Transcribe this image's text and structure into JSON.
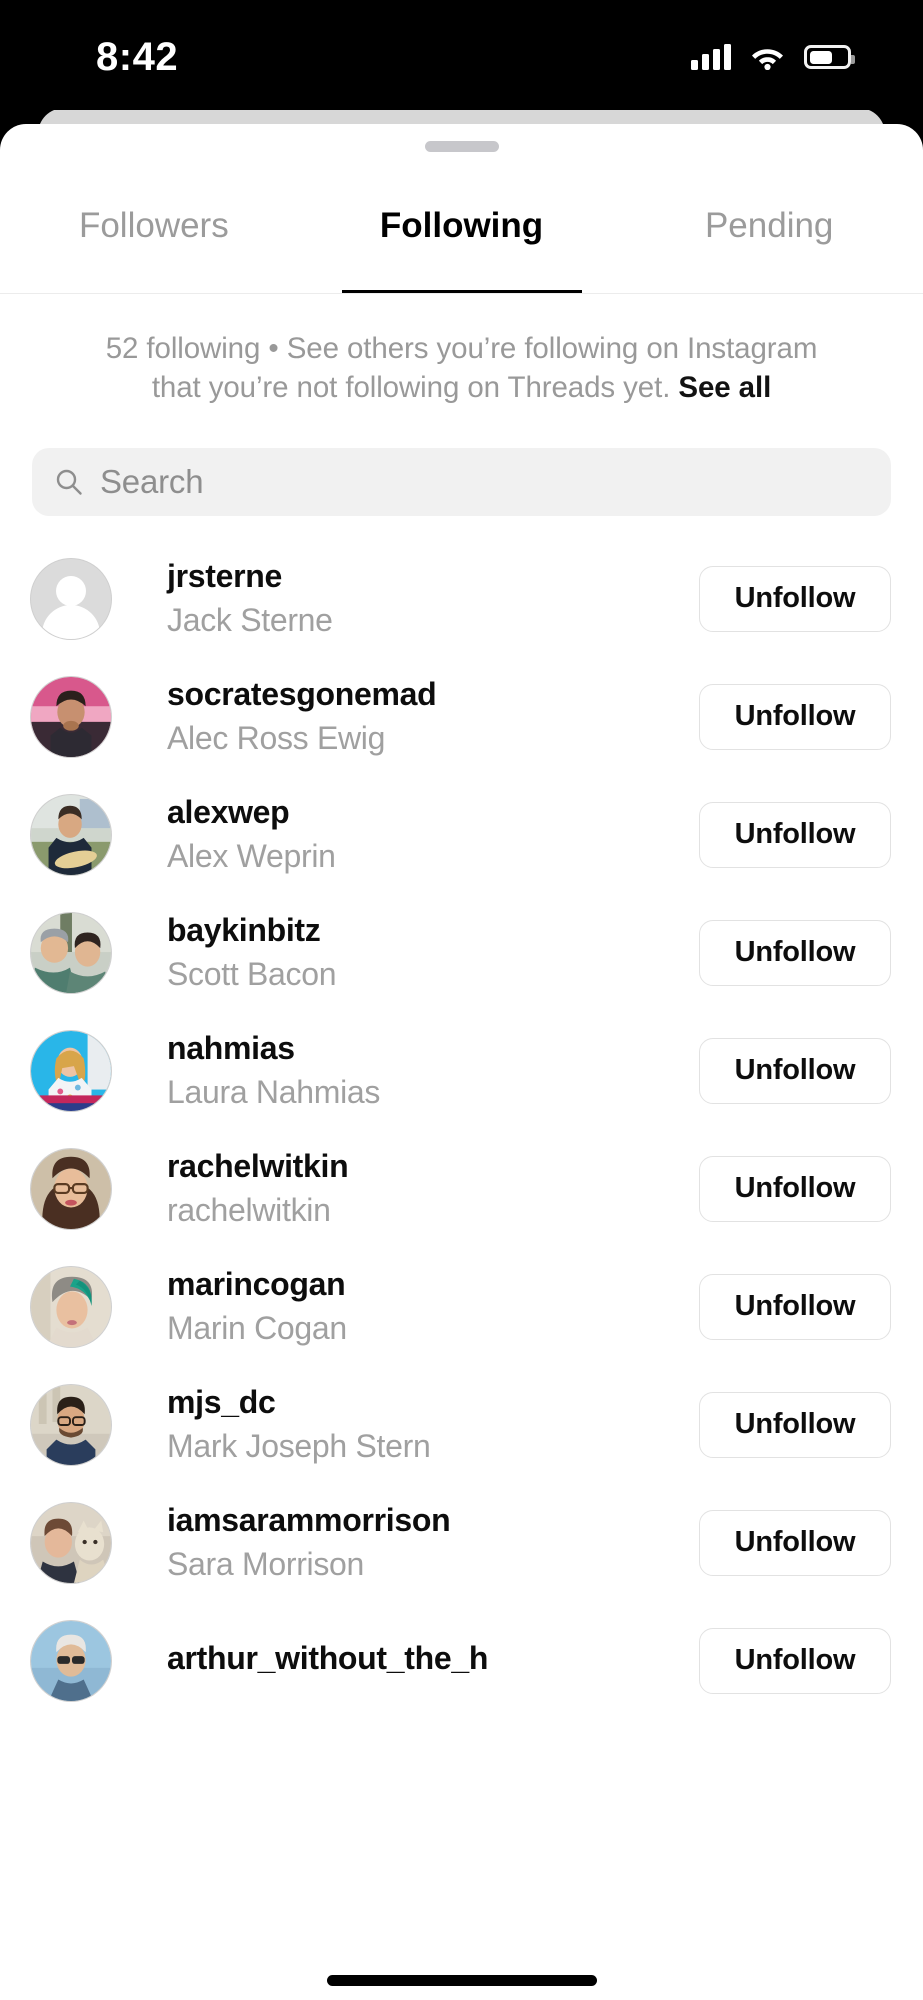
{
  "status_bar": {
    "time": "8:42",
    "cellular_icon": "cellular-signal-icon",
    "wifi_icon": "wifi-icon",
    "battery_icon": "battery-icon",
    "battery_level_pct": 62
  },
  "sheet": {
    "grabber": "drag-handle"
  },
  "tabs": [
    {
      "label": "Followers",
      "active": false
    },
    {
      "label": "Following",
      "active": true
    },
    {
      "label": "Pending",
      "active": false
    }
  ],
  "info": {
    "text": "52 following • See others you’re following on Instagram that you’re not following on Threads yet. ",
    "see_all_label": "See all",
    "following_count": 52
  },
  "search": {
    "placeholder": "Search",
    "value": "",
    "icon": "search-icon"
  },
  "list": {
    "action_label": "Unfollow",
    "rows": [
      {
        "username": "jrsterne",
        "fullname": "Jack Sterne",
        "action": "Unfollow",
        "avatar": "default"
      },
      {
        "username": "socratesgonemad",
        "fullname": "Alec Ross Ewig",
        "action": "Unfollow",
        "avatar": "photo"
      },
      {
        "username": "alexwep",
        "fullname": "Alex Weprin",
        "action": "Unfollow",
        "avatar": "photo"
      },
      {
        "username": "baykinbitz",
        "fullname": "Scott Bacon",
        "action": "Unfollow",
        "avatar": "photo"
      },
      {
        "username": "nahmias",
        "fullname": "Laura Nahmias",
        "action": "Unfollow",
        "avatar": "photo"
      },
      {
        "username": "rachelwitkin",
        "fullname": "rachelwitkin",
        "action": "Unfollow",
        "avatar": "photo"
      },
      {
        "username": "marincogan",
        "fullname": "Marin Cogan",
        "action": "Unfollow",
        "avatar": "photo"
      },
      {
        "username": "mjs_dc",
        "fullname": "Mark Joseph Stern",
        "action": "Unfollow",
        "avatar": "photo"
      },
      {
        "username": "iamsarammorrison",
        "fullname": "Sara Morrison",
        "action": "Unfollow",
        "avatar": "photo"
      },
      {
        "username": "arthur_without_the_h",
        "fullname": "",
        "action": "Unfollow",
        "avatar": "photo"
      }
    ]
  },
  "colors": {
    "accent": "#000000",
    "muted_text": "#a0a0a0",
    "search_bg": "#f1f1f1",
    "border": "#e2e2e2"
  }
}
